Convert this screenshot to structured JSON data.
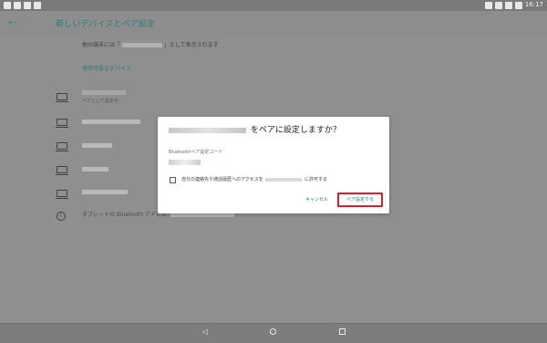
{
  "status_bar": {
    "time": "16:17",
    "left_icons": [
      "tablet-icon",
      "location-icon",
      "image-icon",
      "play-store-icon"
    ],
    "right_icons": [
      "bluetooth-icon",
      "sync-icon",
      "wifi-icon",
      "battery-icon"
    ]
  },
  "app_bar": {
    "title": "新しいデバイスとペア設定",
    "back_icon": "arrow-back-icon"
  },
  "content": {
    "visible_as_prefix": "他の端末には「",
    "visible_as_suffix": "」として表示されます",
    "available_devices_heading": "使用可能なデバイス",
    "pairing_status": "ペアとして設定中...",
    "info_text": "タブレットの Bluetooth アドレス:"
  },
  "dialog": {
    "title_suffix": "をペアに設定しますか？",
    "field_label": "Bluetoothペア設定コード",
    "checkbox_prefix": "自分の連絡先や通話履歴へのアクセスを",
    "checkbox_suffix": "に許可する",
    "cancel_label": "キャンセル",
    "pair_label": "ペア設定する"
  },
  "navigation": {
    "back_icon": "nav-back-icon",
    "home_icon": "nav-home-icon",
    "recent_icon": "nav-recent-icon"
  },
  "colors": {
    "accent": "#1d7f6f",
    "highlight": "#e11b2f"
  }
}
